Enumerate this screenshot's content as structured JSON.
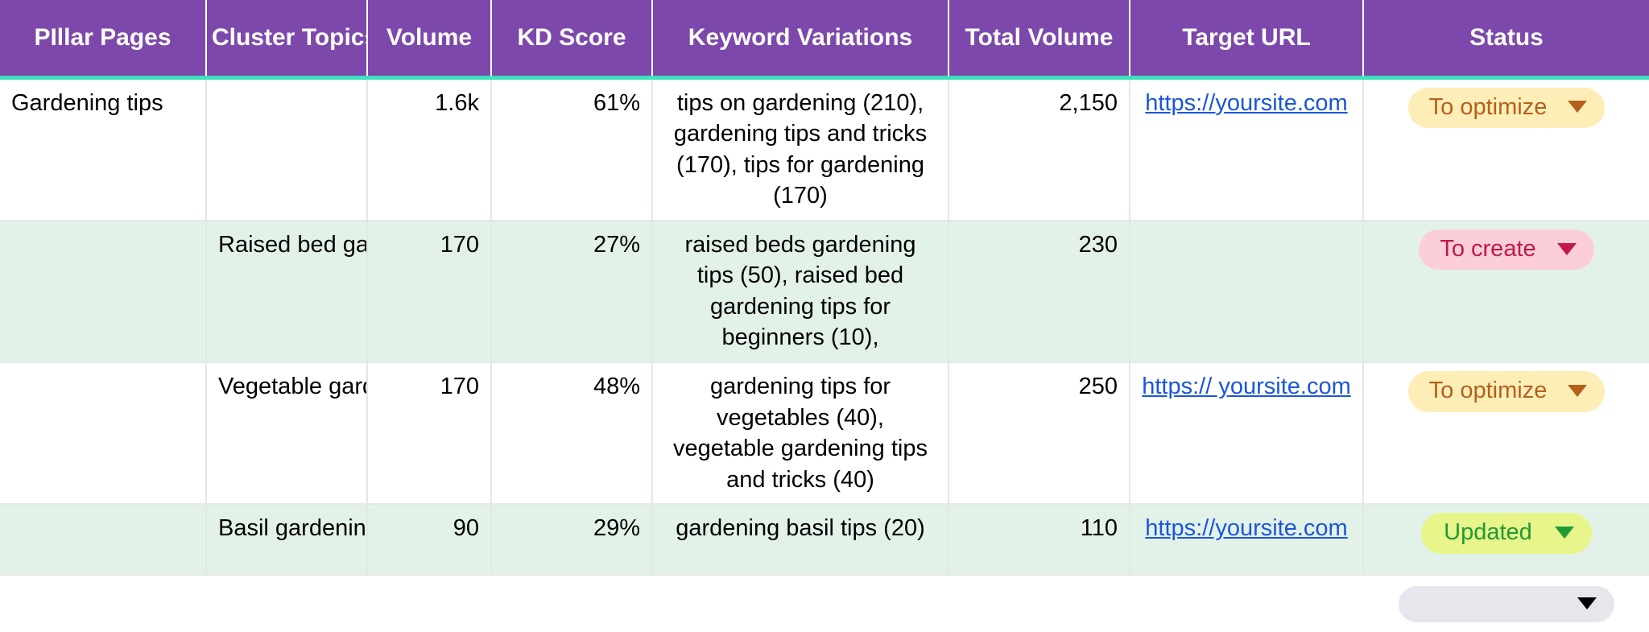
{
  "table": {
    "columns": [
      {
        "key": "pillar_pages",
        "label": "PIllar Pages"
      },
      {
        "key": "cluster_topics",
        "label": "Cluster Topics"
      },
      {
        "key": "volume",
        "label": "Volume"
      },
      {
        "key": "kd_score",
        "label": "KD Score"
      },
      {
        "key": "keyword_variations",
        "label": "Keyword Variations"
      },
      {
        "key": "total_volume",
        "label": "Total Volume"
      },
      {
        "key": "target_url",
        "label": "Target URL"
      },
      {
        "key": "status",
        "label": "Status"
      }
    ],
    "rows": [
      {
        "pillar_pages": "Gardening tips",
        "cluster_topics": "",
        "volume": "1.6k",
        "kd_score": "61%",
        "keyword_variations": "tips on gardening (210), gardening tips and tricks (170), tips for gardening (170)",
        "total_volume": "2,150",
        "target_url": "https://yoursite.com",
        "status": "To optimize",
        "status_variant": "optimize",
        "band": "white"
      },
      {
        "pillar_pages": "",
        "cluster_topics": "Raised bed garde",
        "volume": "170",
        "kd_score": "27%",
        "keyword_variations": "raised beds gardening tips (50), raised bed gardening tips for beginners (10),",
        "total_volume": "230",
        "target_url": "",
        "status": "To create",
        "status_variant": "create",
        "band": "green"
      },
      {
        "pillar_pages": "",
        "cluster_topics": "Vegetable garden",
        "volume": "170",
        "kd_score": "48%",
        "keyword_variations": "gardening tips for vegetables (40), vegetable gardening tips and tricks (40)",
        "total_volume": "250",
        "target_url": "https:// yoursite.com",
        "status": "To optimize",
        "status_variant": "optimize",
        "band": "white"
      },
      {
        "pillar_pages": "",
        "cluster_topics": "Basil gardening t",
        "volume": "90",
        "kd_score": "29%",
        "keyword_variations": "gardening basil tips (20)",
        "total_volume": "110",
        "target_url": "https://yoursite.com",
        "status": "Updated",
        "status_variant": "updated",
        "band": "green"
      }
    ],
    "trailing_row": {
      "status_placeholder": ""
    }
  },
  "icons": {
    "caret": "chevron-down-icon"
  },
  "colors": {
    "header_background": "#7d48ab",
    "header_text": "#ffffff",
    "header_accent_underline": "#3fe0c0",
    "row_alt_background": "#e3f2e8",
    "row_background": "#ffffff",
    "link": "#1a56db",
    "status_optimize_bg": "#fdeeb8",
    "status_optimize_text": "#b5601a",
    "status_create_bg": "#fccfd8",
    "status_create_text": "#c2174b",
    "status_updated_bg": "#e7f58a",
    "status_updated_text": "#1f9a36",
    "status_empty_bg": "#e6e6ec"
  }
}
